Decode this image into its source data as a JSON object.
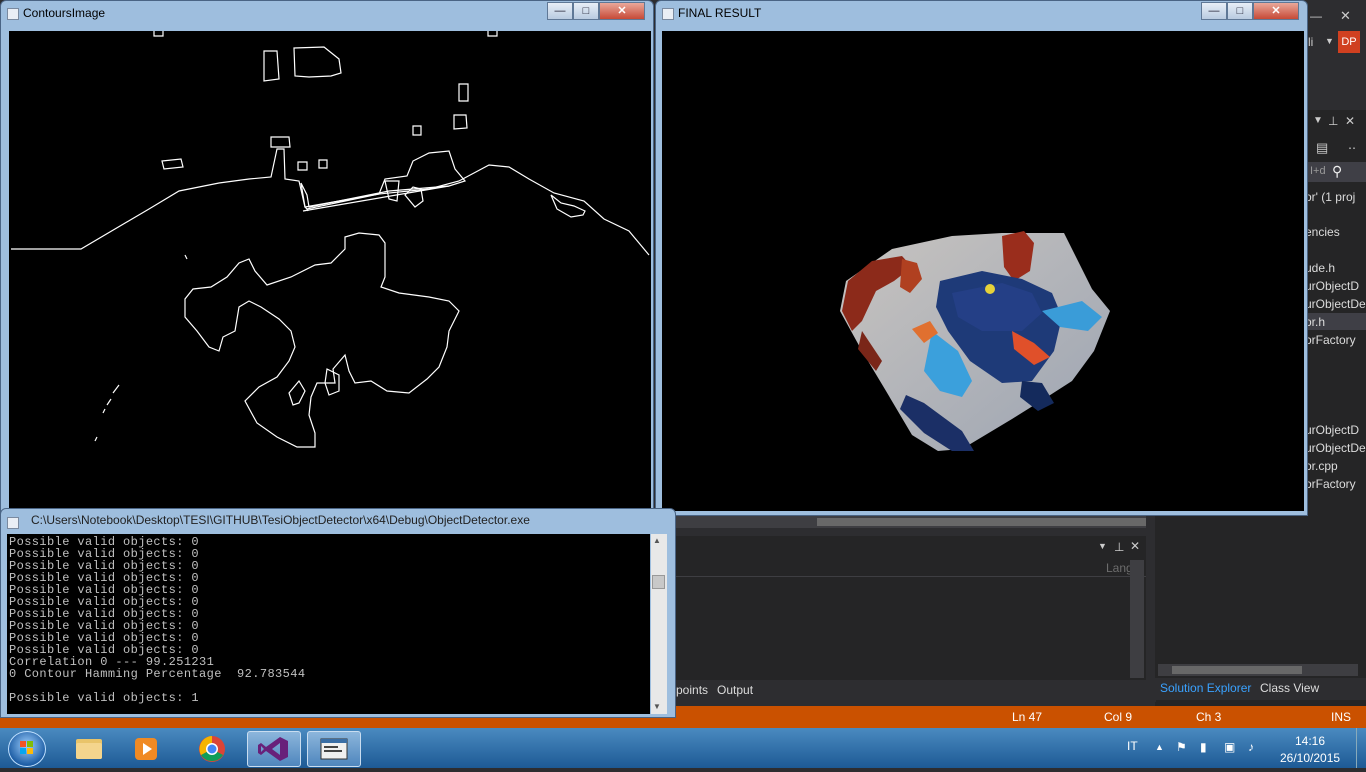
{
  "contours_window": {
    "title": "ContoursImage"
  },
  "final_window": {
    "title": "FINAL RESULT"
  },
  "console_window": {
    "title": "C:\\Users\\Notebook\\Desktop\\TESI\\GITHUB\\TesiObjectDetector\\x64\\Debug\\ObjectDetector.exe",
    "lines": [
      "Possible valid objects: 0",
      "Possible valid objects: 0",
      "Possible valid objects: 0",
      "Possible valid objects: 0",
      "Possible valid objects: 0",
      "Possible valid objects: 0",
      "Possible valid objects: 0",
      "Possible valid objects: 0",
      "Possible valid objects: 0",
      "Possible valid objects: 0",
      "Correlation 0 --- 99.251231",
      "0 Contour Hamming Percentage  92.783544",
      "",
      "Possible valid objects: 1"
    ]
  },
  "vs": {
    "user_badge": "DP",
    "top_letters": "li",
    "solution_explorer": {
      "items": [
        "or' (1 proj",
        "encies",
        "ude.h",
        "urObjectD",
        "urObjectDe",
        "or.h",
        "orFactory",
        "urObjectD",
        "urObjectDe",
        "or.cpp",
        "orFactory"
      ],
      "search_glyph": "I+d"
    },
    "output_panel": {
      "lang_label": "Lang"
    },
    "bottom_tabs": {
      "breakpoints": "points",
      "output": "Output",
      "solution_explorer": "Solution Explorer",
      "class_view": "Class View"
    },
    "status": {
      "line": "Ln 47",
      "col": "Col 9",
      "ch": "Ch 3",
      "mode": "INS"
    }
  },
  "taskbar": {
    "lang": "IT",
    "time": "14:16",
    "date": "26/10/2015"
  },
  "colors": {
    "status_bar": "#ca5100",
    "vs_bg": "#2d2d30",
    "taskbar": "#1d5a95"
  }
}
